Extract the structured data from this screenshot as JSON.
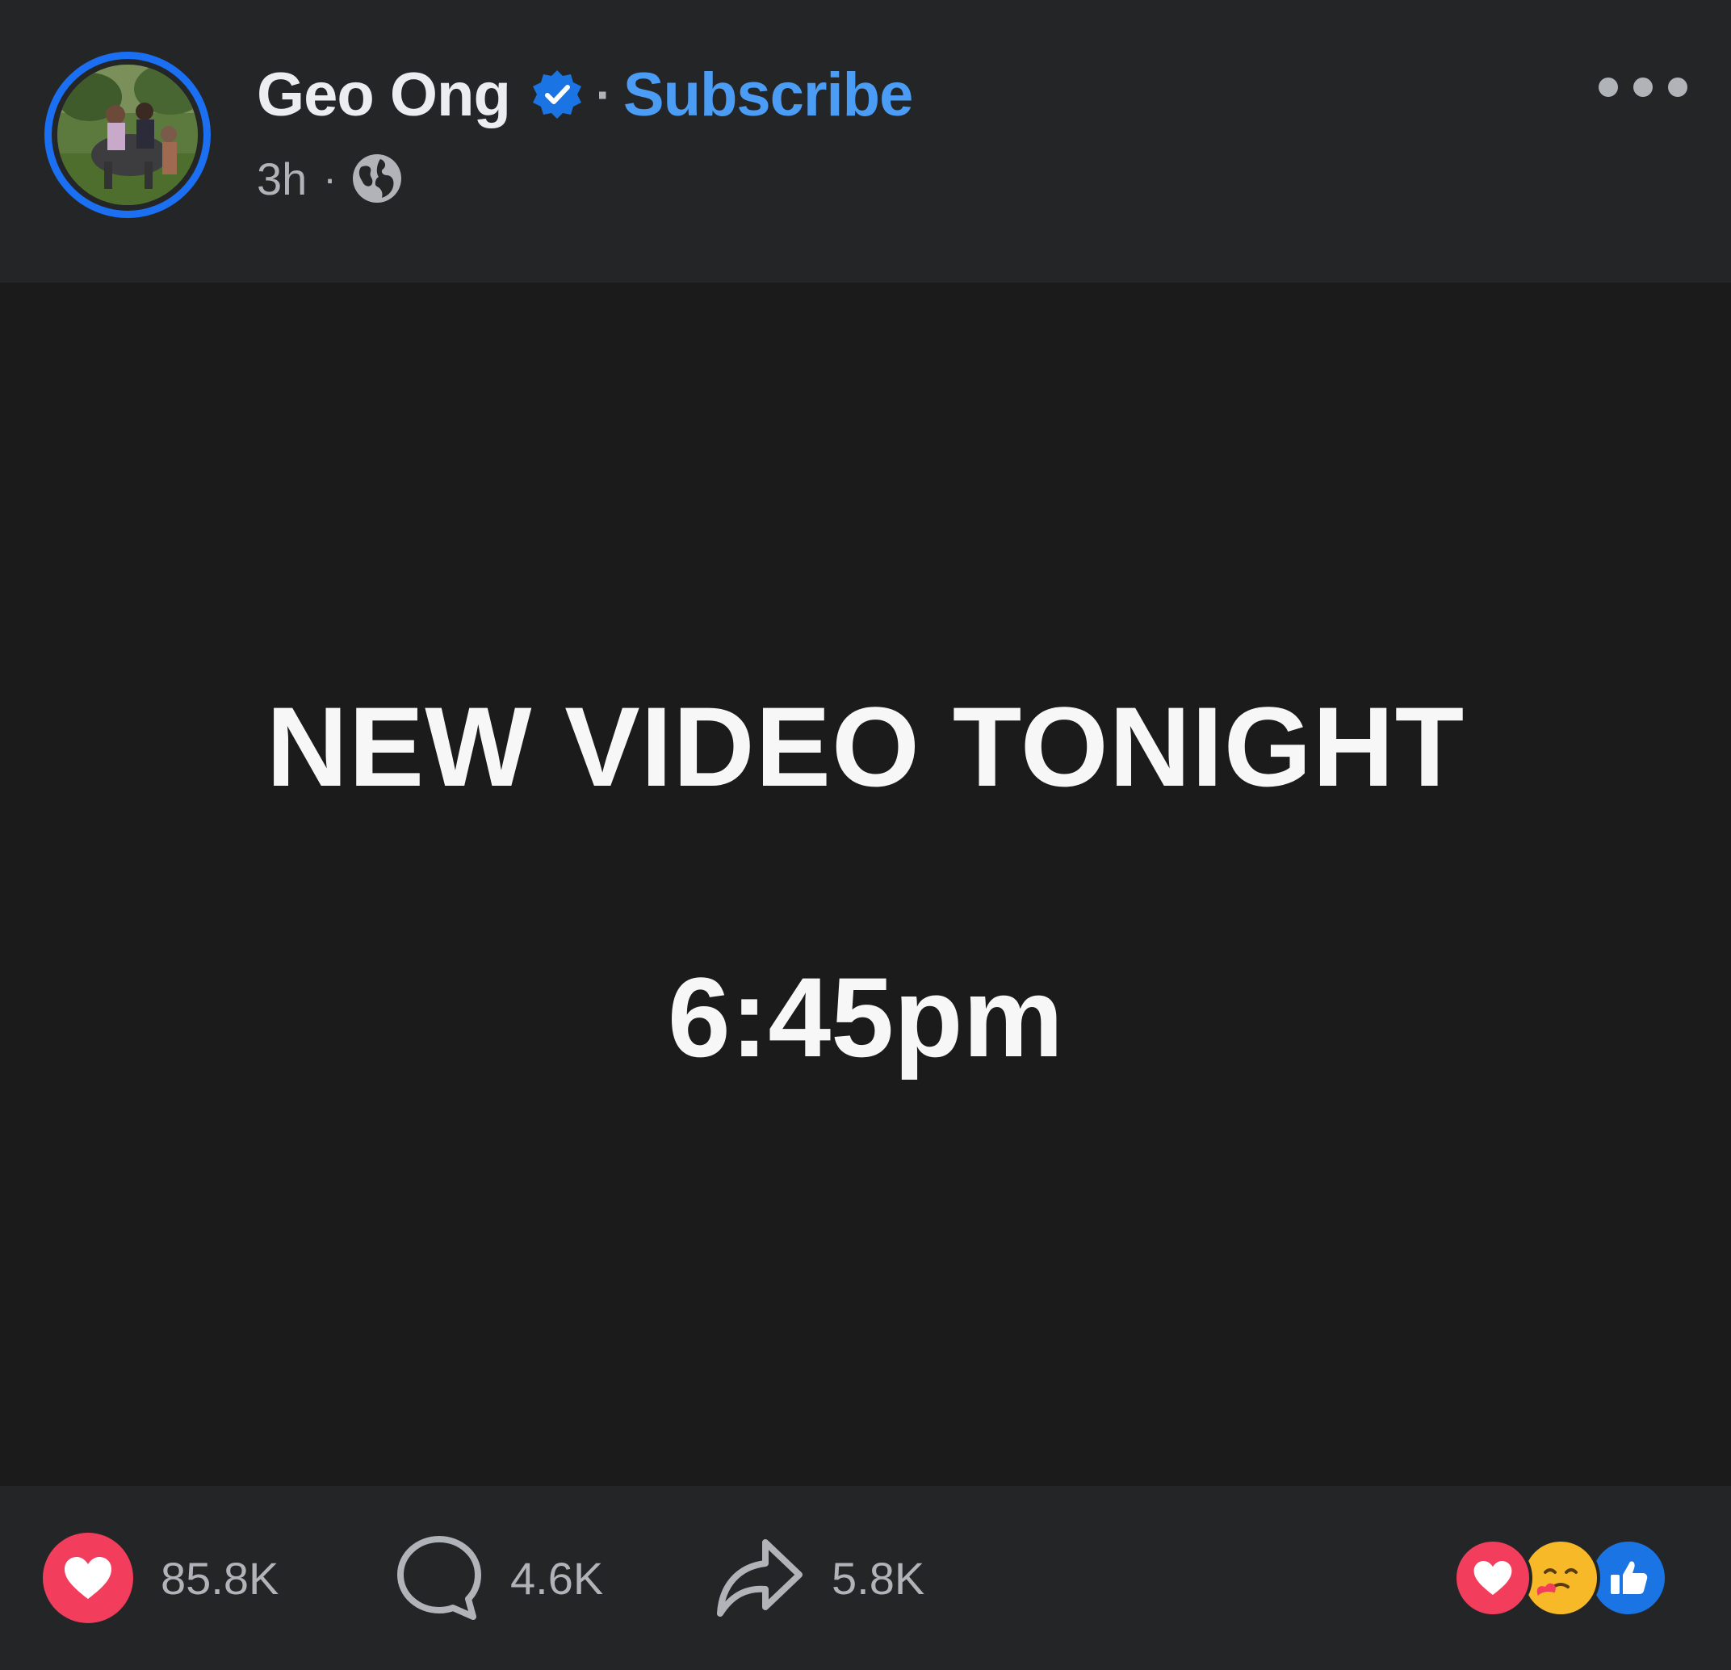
{
  "post": {
    "author": {
      "name": "Geo Ong",
      "avatar_icon": "profile-photo",
      "verified_icon": "verified-badge-icon"
    },
    "separator": "·",
    "subscribe_label": "Subscribe",
    "timestamp": "3h",
    "privacy_icon": "globe-icon",
    "more_icon": "more-options-icon"
  },
  "media": {
    "headline": "NEW VIDEO TONIGHT",
    "time": "6:45pm"
  },
  "stats": {
    "reactions_count": "85.8K",
    "comments_count": "4.6K",
    "shares_count": "5.8K"
  },
  "reaction_summary": [
    "love",
    "care",
    "like"
  ],
  "colors": {
    "background": "#242526",
    "media_background": "#1b1b1c",
    "accent_blue": "#1b6ff2",
    "subscribe_blue": "#4b9cf5",
    "love_red": "#f23e5c",
    "muted_text": "#b0b3b8"
  }
}
